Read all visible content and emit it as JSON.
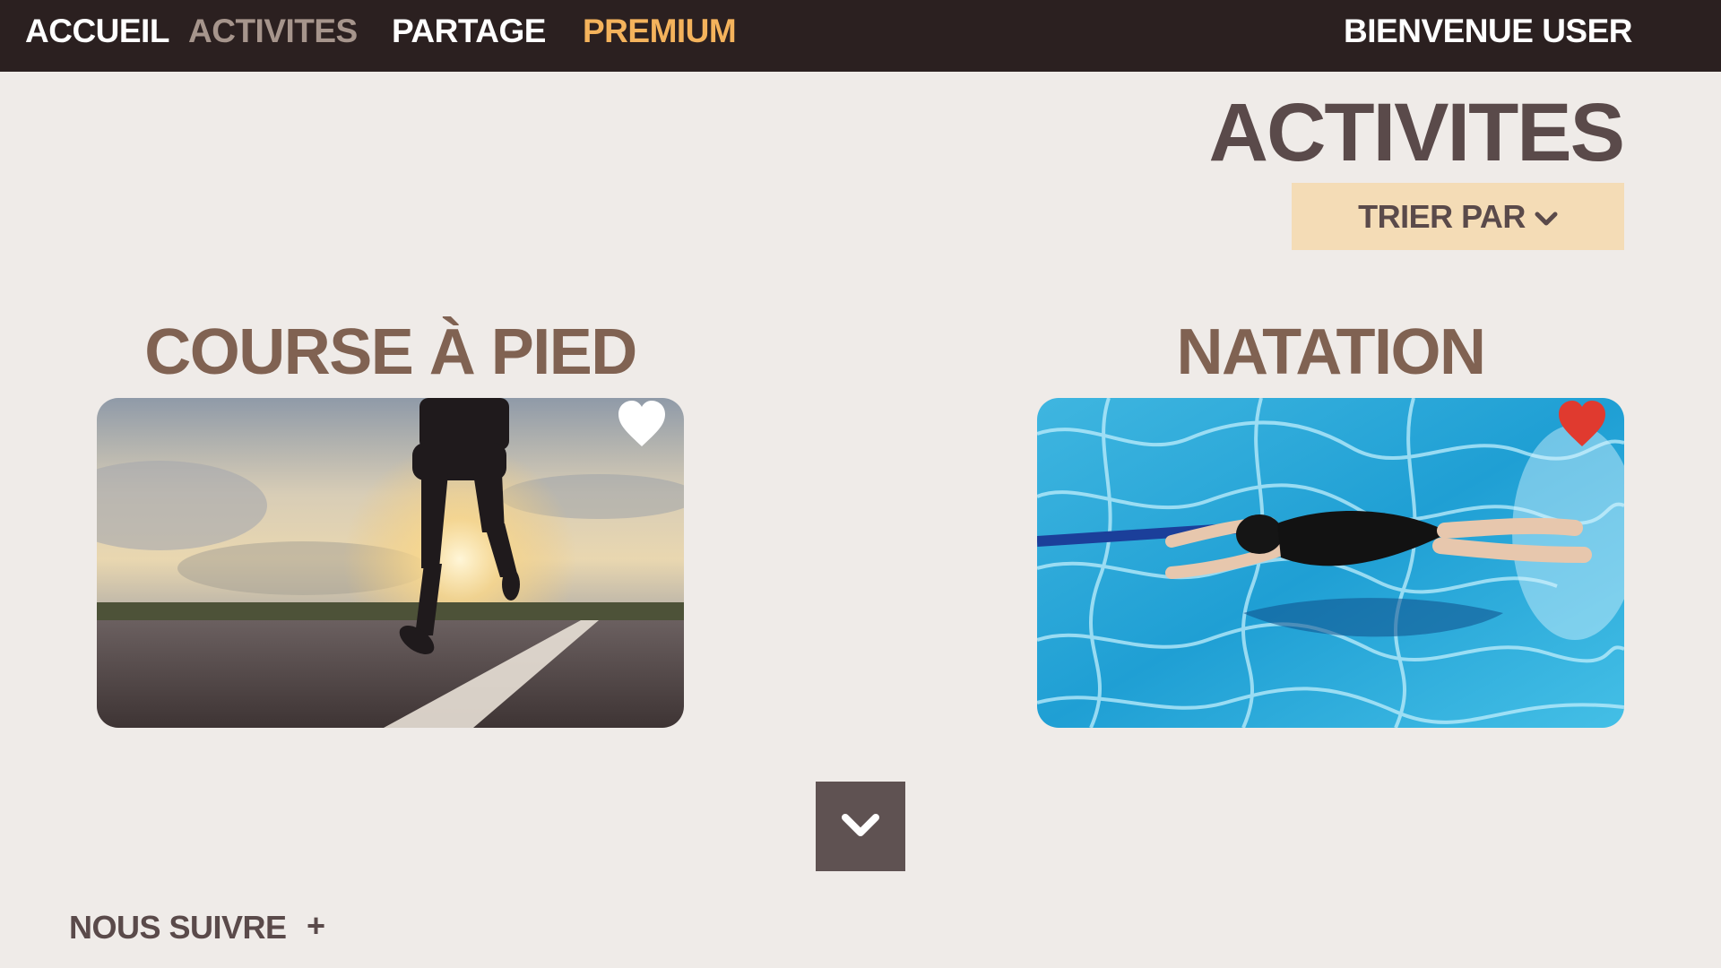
{
  "nav": {
    "home": "ACCUEIL",
    "activities": "ACTIVITES",
    "share": "PARTAGE",
    "premium": "PREMIUM",
    "welcome": "BIENVENUE USER"
  },
  "page": {
    "title": "ACTIVITES",
    "sort_label": "TRIER PAR"
  },
  "activities": [
    {
      "title": "COURSE À PIED",
      "image": "runner-on-road-at-sunset",
      "favorite": false
    },
    {
      "title": "NATATION",
      "image": "swimmer-in-pool",
      "favorite": true
    }
  ],
  "footer": {
    "follow": "NOUS SUIVRE",
    "follow_toggle": "+"
  },
  "colors": {
    "topbar": "#2b2020",
    "background": "#efebe8",
    "nav_active": "#a6958c",
    "premium": "#f4b35c",
    "title": "#5a4a4a",
    "card_title": "#806252",
    "sort_bg": "#f4dcb6",
    "favorite_on": "#e03a2f",
    "favorite_off": "#ffffff",
    "scroll_button": "#5f5252"
  },
  "icons": {
    "sort": "chevron-down-icon",
    "favorite": "heart-icon",
    "scroll": "chevron-down-icon"
  }
}
